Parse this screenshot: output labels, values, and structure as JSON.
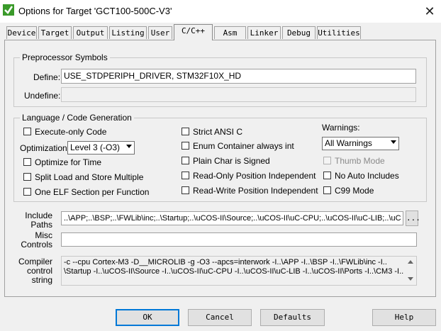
{
  "window": {
    "title": "Options for Target 'GCT100-500C-V3'"
  },
  "tabs": [
    "Device",
    "Target",
    "Output",
    "Listing",
    "User",
    "C/C++",
    "Asm",
    "Linker",
    "Debug",
    "Utilities"
  ],
  "active_tab": "C/C++",
  "preprocessor": {
    "legend": "Preprocessor Symbols",
    "define_label": "Define:",
    "define_value": "USE_STDPERIPH_DRIVER, STM32F10X_HD",
    "undefine_label": "Undefine:",
    "undefine_value": ""
  },
  "language": {
    "legend": "Language / Code Generation",
    "execute_only": {
      "label": "Execute-only Code",
      "checked": false
    },
    "optimization_label": "Optimization:",
    "optimization_value": "Level 3 (-O3)",
    "optimize_time": {
      "label": "Optimize for Time",
      "checked": false
    },
    "split_load": {
      "label": "Split Load and Store Multiple",
      "checked": false
    },
    "one_elf": {
      "label": "One ELF Section per Function",
      "checked": false
    },
    "strict_ansi": {
      "label": "Strict ANSI C",
      "checked": false
    },
    "enum_int": {
      "label": "Enum Container always int",
      "checked": false
    },
    "plain_char": {
      "label": "Plain Char is Signed",
      "checked": false
    },
    "ro_pi": {
      "label": "Read-Only Position Independent",
      "checked": false
    },
    "rw_pi": {
      "label": "Read-Write Position Independent",
      "checked": false
    },
    "warnings_label": "Warnings:",
    "warnings_value": "All Warnings",
    "thumb_mode": {
      "label": "Thumb Mode",
      "checked": false,
      "enabled": false
    },
    "no_auto": {
      "label": "No Auto Includes",
      "checked": false
    },
    "c99": {
      "label": "C99 Mode",
      "checked": false
    }
  },
  "include_paths": {
    "label_line1": "Include",
    "label_line2": "Paths",
    "value": "..\\APP;..\\BSP;..\\FWLib\\inc;..\\Startup;..\\uCOS-II\\Source;..\\uCOS-II\\uC-CPU;..\\uCOS-II\\uC-LIB;..\\uC",
    "browse_label": "..."
  },
  "misc": {
    "label_line1": "Misc",
    "label_line2": "Controls",
    "value": ""
  },
  "compiler": {
    "label_line1": "Compiler",
    "label_line2": "control",
    "label_line3": "string",
    "line1": "-c --cpu Cortex-M3 -D__MICROLIB -g -O3 --apcs=interwork -I..\\APP -I..\\BSP -I..\\FWLib\\inc -I..",
    "line2": "\\Startup -I..\\uCOS-II\\Source -I..\\uCOS-II\\uC-CPU -I..\\uCOS-II\\uC-LIB -I..\\uCOS-II\\Ports -I..\\CM3 -I.."
  },
  "buttons": {
    "ok": "OK",
    "cancel": "Cancel",
    "defaults": "Defaults",
    "help": "Help"
  },
  "colors": {
    "accent": "#0078d7",
    "icon_green": "#3a9a2a",
    "panel_bg": "#f0f0f0"
  }
}
